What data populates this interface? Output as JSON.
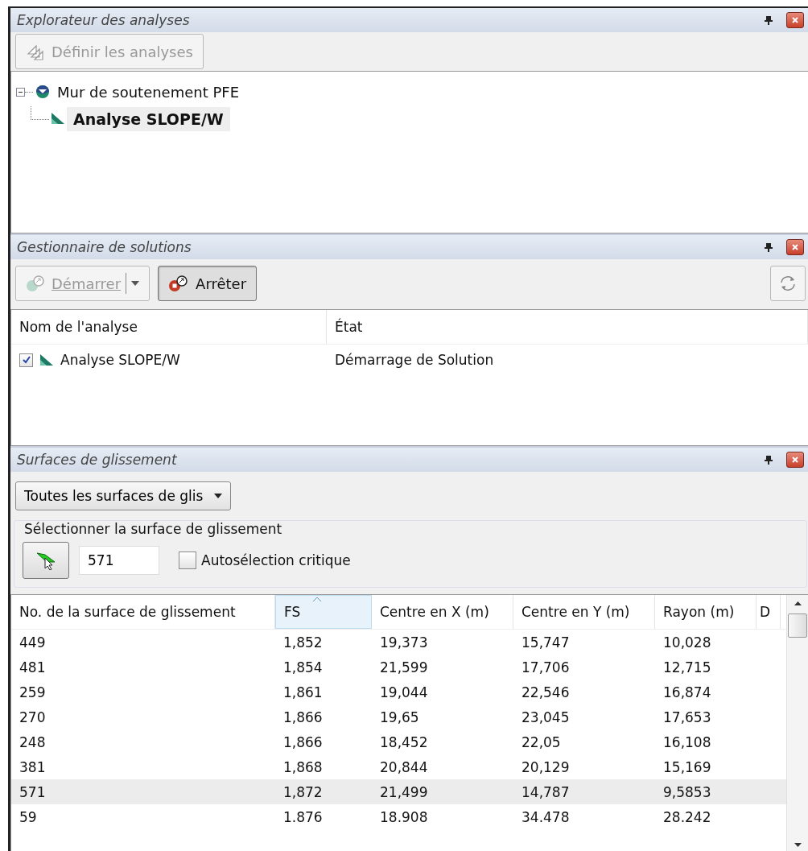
{
  "explorer": {
    "title": "Explorateur des analyses",
    "define_button": {
      "label": "Définir les analyses",
      "disabled": true
    },
    "tree": [
      {
        "label": "Mur de soutenement PFE",
        "expanded": true,
        "kind": "project",
        "children": [
          {
            "label": "Analyse SLOPE/W",
            "kind": "analysis",
            "selected": true
          }
        ]
      }
    ]
  },
  "solver": {
    "title": "Gestionnaire de solutions",
    "start_button": {
      "label": "Démarrer",
      "disabled": true
    },
    "stop_button": {
      "label": "Arrêter",
      "disabled": false
    },
    "columns": [
      "Nom de l'analyse",
      "État"
    ],
    "rows": [
      {
        "checked": true,
        "name": "Analyse SLOPE/W",
        "state": "Démarrage de Solution"
      }
    ]
  },
  "surfaces": {
    "title": "Surfaces de glissement",
    "filter": "Toutes les surfaces de glis",
    "group_label": "Sélectionner la surface de glissement",
    "surface_value": "571",
    "auto_critical": {
      "label": "Autosélection critique",
      "checked": false
    },
    "columns": [
      {
        "label": "No. de la surface de glissement",
        "sorted": false
      },
      {
        "label": "FS",
        "sorted": true
      },
      {
        "label": "Centre en X (m)",
        "sorted": false
      },
      {
        "label": "Centre en Y (m)",
        "sorted": false
      },
      {
        "label": "Rayon (m)",
        "sorted": false
      },
      {
        "label": "D",
        "sorted": false
      }
    ],
    "rows": [
      {
        "selected": false,
        "cells": [
          "449",
          "1,852",
          "19,373",
          "15,747",
          "10,028"
        ]
      },
      {
        "selected": false,
        "cells": [
          "481",
          "1,854",
          "21,599",
          "17,706",
          "12,715"
        ]
      },
      {
        "selected": false,
        "cells": [
          "259",
          "1,861",
          "19,044",
          "22,546",
          "16,874"
        ]
      },
      {
        "selected": false,
        "cells": [
          "270",
          "1,866",
          "19,65",
          "23,045",
          "17,653"
        ]
      },
      {
        "selected": false,
        "cells": [
          "248",
          "1,866",
          "18,452",
          "22,05",
          "16,108"
        ]
      },
      {
        "selected": false,
        "cells": [
          "381",
          "1,868",
          "20,844",
          "20,129",
          "15,169"
        ]
      },
      {
        "selected": true,
        "cells": [
          "571",
          "1,872",
          "21,499",
          "14,787",
          "9,5853"
        ]
      },
      {
        "selected": false,
        "cells": [
          "59",
          "1.876",
          "18.908",
          "34.478",
          "28.242"
        ]
      }
    ]
  }
}
